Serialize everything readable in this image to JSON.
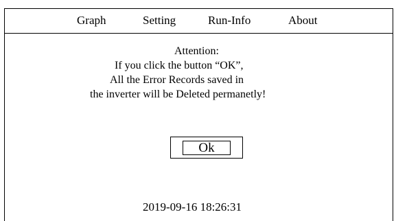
{
  "menu": {
    "items": [
      {
        "label": "Graph"
      },
      {
        "label": "Setting"
      },
      {
        "label": "Run-Info"
      },
      {
        "label": "About"
      }
    ]
  },
  "dialog": {
    "lines": [
      "Attention:",
      "If you click the button “OK”,",
      "All the  Error Records saved in",
      "the inverter will be Deleted permanetly!"
    ],
    "ok_label": "Ok"
  },
  "status": {
    "datetime": "2019-09-16 18:26:31"
  }
}
